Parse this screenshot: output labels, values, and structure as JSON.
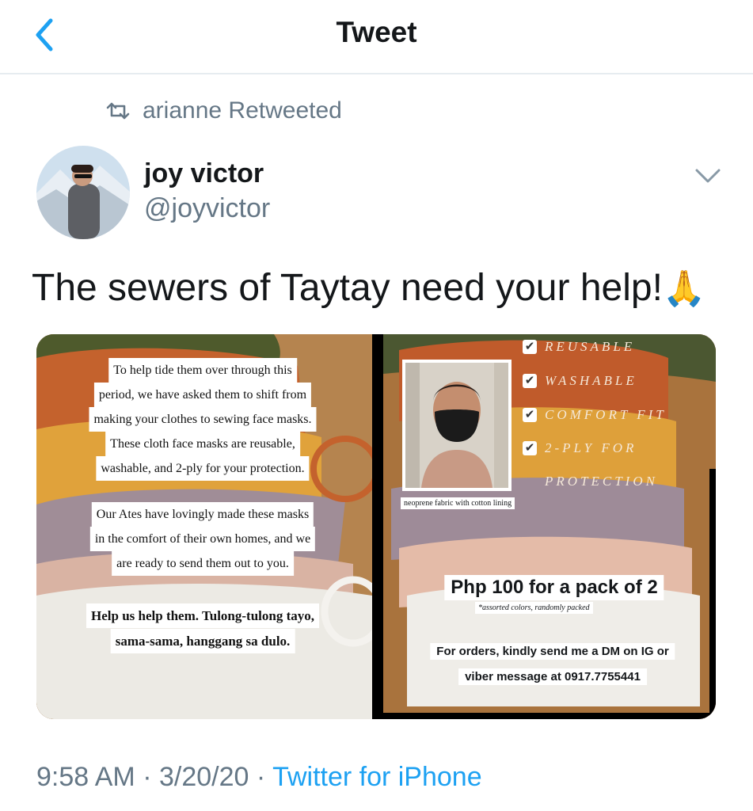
{
  "header": {
    "title": "Tweet",
    "back_icon": "chevron-left-icon"
  },
  "retweet": {
    "icon": "retweet-icon",
    "text": "arianne Retweeted"
  },
  "author": {
    "name": "joy victor",
    "handle": "@joyvictor"
  },
  "tweet": {
    "text": "The sewers of Taytay need your help!",
    "emoji": "🙏"
  },
  "media": {
    "left_panel": {
      "paragraph1": [
        "To help tide them over through this",
        "period, we have asked them to shift from",
        "making your clothes to sewing face masks.",
        "These cloth face masks are reusable,",
        "washable, and 2-ply for your protection."
      ],
      "paragraph2": [
        "Our Ates have lovingly made these masks",
        "in the comfort of their own homes, and we",
        "are ready to send them out to you."
      ],
      "paragraph3": [
        "Help us help them. Tulong-tulong tayo,",
        "sama-sama, hanggang sa dulo."
      ]
    },
    "right_panel": {
      "features": [
        "REUSABLE",
        "WASHABLE",
        "COMFORT FIT",
        "2-PLY FOR"
      ],
      "feature_cont": "PROTECTION",
      "photo_caption": "neoprene fabric with cotton lining",
      "price": "Php 100 for a pack of 2",
      "price_note": "*assorted colors, randomly packed",
      "orders": [
        "For orders, kindly send me a DM on IG or",
        "viber message at 0917.7755441"
      ]
    }
  },
  "footer": {
    "time": "9:58 AM",
    "date": "3/20/20",
    "separator": "·",
    "source": "Twitter for iPhone"
  },
  "colors": {
    "link": "#1da1f2",
    "muted": "#657786"
  }
}
